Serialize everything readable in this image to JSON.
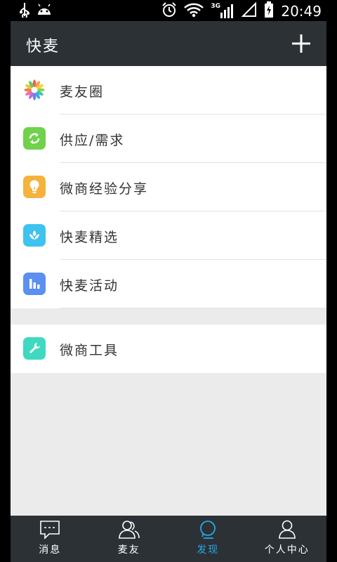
{
  "status_bar": {
    "time": "20:49",
    "network": "3G",
    "icons": [
      "usb-icon",
      "android-icon",
      "alarm-icon",
      "wifi-icon",
      "signal-icon",
      "no-sim-icon",
      "battery-charging-icon"
    ]
  },
  "header": {
    "title": "快麦",
    "add_icon": "plus-icon"
  },
  "menu": {
    "group1": [
      {
        "label": "麦友圈",
        "icon": "pinwheel-icon",
        "color": "#ffffff"
      },
      {
        "label": "供应/需求",
        "icon": "refresh-icon",
        "color": "#6fd24a"
      },
      {
        "label": "微商经验分享",
        "icon": "lightbulb-icon",
        "color": "#f5b23c"
      },
      {
        "label": "快麦精选",
        "icon": "wheat-icon",
        "color": "#3ec2f0"
      },
      {
        "label": "快麦活动",
        "icon": "bar-chart-icon",
        "color": "#5b8ff0"
      }
    ],
    "group2": [
      {
        "label": "微商工具",
        "icon": "wrench-icon",
        "color": "#3fd9c1"
      }
    ]
  },
  "tabs": [
    {
      "label": "消息",
      "icon": "message-icon"
    },
    {
      "label": "麦友",
      "icon": "friends-icon"
    },
    {
      "label": "发现",
      "icon": "discover-icon",
      "active": true
    },
    {
      "label": "个人中心",
      "icon": "profile-icon"
    }
  ],
  "colors": {
    "titlebar": "#2b3135",
    "background": "#ebebeb",
    "active_tab": "#2aa6e9"
  }
}
